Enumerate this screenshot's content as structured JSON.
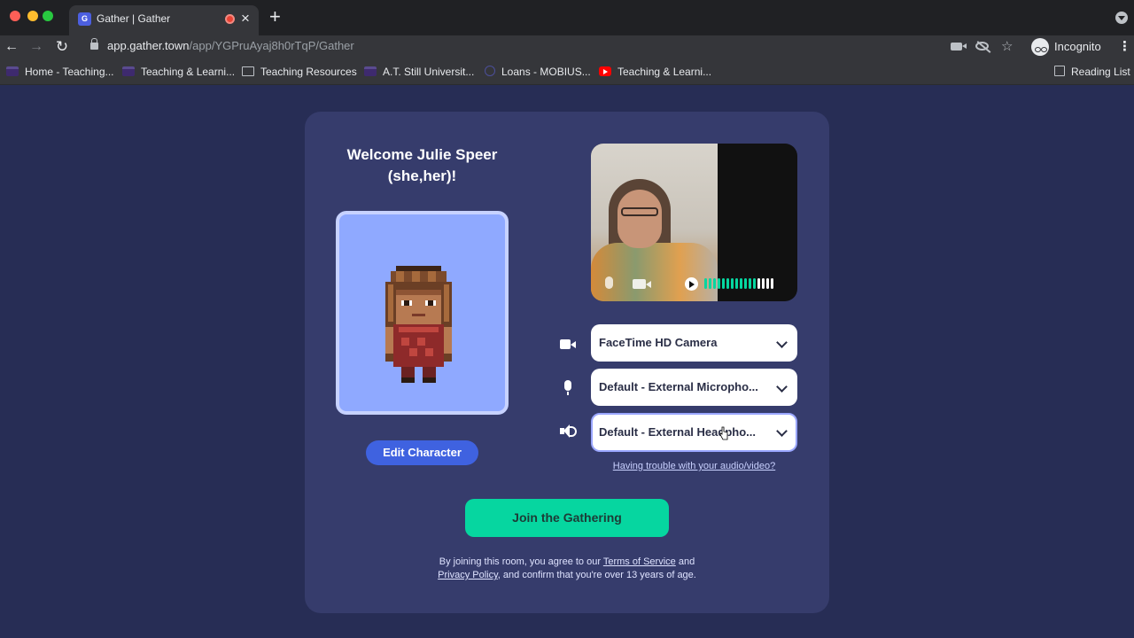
{
  "browser": {
    "tab_title": "Gather | Gather",
    "favicon_text": "G",
    "close_glyph": "×",
    "new_tab_glyph": "+",
    "url_host": "app.gather.town",
    "url_path": "/app/YGPruAyaj8h0rTqP/Gather",
    "profile_label": "Incognito",
    "icons": [
      "back-icon",
      "forward-icon",
      "reload-icon",
      "lock-icon",
      "camera-icon",
      "eye-off-icon",
      "star-icon",
      "incognito-icon",
      "more-icon"
    ],
    "nav_glyphs": {
      "back": "←",
      "forward": "→",
      "reload": "↻",
      "star": "☆",
      "more": "⋮"
    },
    "bookmarks": [
      {
        "label": "Home - Teaching...",
        "icon": "atsu-icon"
      },
      {
        "label": "Teaching & Learni...",
        "icon": "atsu-icon"
      },
      {
        "label": "Teaching Resources",
        "icon": "folder-icon"
      },
      {
        "label": "A.T. Still Universit...",
        "icon": "atsu-icon"
      },
      {
        "label": "Loans - MOBIUS...",
        "icon": "circle-icon"
      },
      {
        "label": "Teaching & Learni...",
        "icon": "youtube-icon"
      }
    ],
    "reading_list": "Reading List"
  },
  "welcome": {
    "line1": "Welcome Julie Speer",
    "line2": "(she,her)!"
  },
  "edit_character_label": "Edit Character",
  "devices": {
    "camera": "FaceTime HD Camera",
    "microphone": "Default - External Micropho...",
    "speaker": "Default - External Headpho..."
  },
  "trouble_link": "Having trouble with your audio/video?",
  "join_label": "Join the Gathering",
  "terms": {
    "prefix": "By joining this room, you agree to our",
    "tos": "Terms of Service",
    "and": "and",
    "privacy": "Privacy Policy",
    "suffix": ", and confirm that you're over 13 years of age."
  },
  "colors": {
    "page_bg": "#272d55",
    "card_bg": "#363c6c",
    "join_button": "#06d6a0",
    "edit_button": "#3f62e0",
    "avatar_bg": "#8fa9ff",
    "meter_active": "#06d6a0"
  },
  "audio_meter": {
    "active_bars": 12,
    "total_bars": 16
  }
}
